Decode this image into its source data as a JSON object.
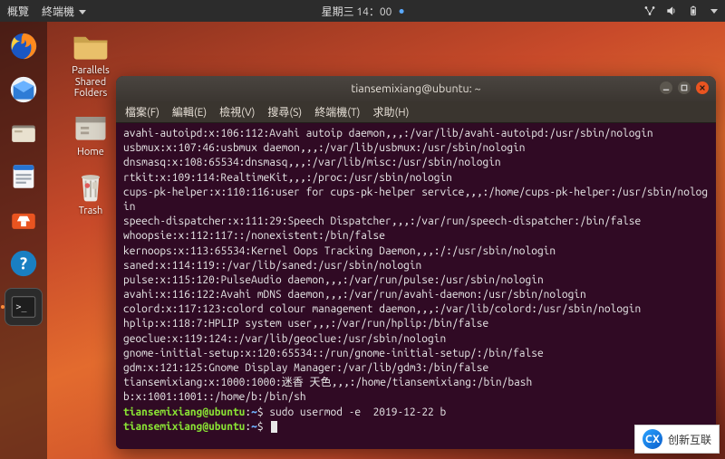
{
  "top_panel": {
    "overview": "概覽",
    "app_name": "終端機",
    "clock": "星期三 14：00"
  },
  "desktop_icons": {
    "parallels": "Parallels\nShared\nFolders",
    "home": "Home",
    "trash": "Trash"
  },
  "terminal": {
    "title": "tiansemixiang@ubuntu: ~",
    "menu": {
      "file": "檔案(F)",
      "edit": "編輯(E)",
      "view": "檢視(V)",
      "search": "搜尋(S)",
      "terminal": "終端機(T)",
      "help": "求助(H)"
    },
    "lines": [
      "avahi-autoipd:x:106:112:Avahi autoip daemon,,,:/var/lib/avahi-autoipd:/usr/sbin/nologin",
      "usbmux:x:107:46:usbmux daemon,,,:/var/lib/usbmux:/usr/sbin/nologin",
      "dnsmasq:x:108:65534:dnsmasq,,,:/var/lib/misc:/usr/sbin/nologin",
      "rtkit:x:109:114:RealtimeKit,,,:/proc:/usr/sbin/nologin",
      "cups-pk-helper:x:110:116:user for cups-pk-helper service,,,:/home/cups-pk-helper:/usr/sbin/nologin",
      "speech-dispatcher:x:111:29:Speech Dispatcher,,,:/var/run/speech-dispatcher:/bin/false",
      "whoopsie:x:112:117::/nonexistent:/bin/false",
      "kernoops:x:113:65534:Kernel Oops Tracking Daemon,,,:/:/usr/sbin/nologin",
      "saned:x:114:119::/var/lib/saned:/usr/sbin/nologin",
      "pulse:x:115:120:PulseAudio daemon,,,:/var/run/pulse:/usr/sbin/nologin",
      "avahi:x:116:122:Avahi mDNS daemon,,,:/var/run/avahi-daemon:/usr/sbin/nologin",
      "colord:x:117:123:colord colour management daemon,,,:/var/lib/colord:/usr/sbin/nologin",
      "hplip:x:118:7:HPLIP system user,,,:/var/run/hplip:/bin/false",
      "geoclue:x:119:124::/var/lib/geoclue:/usr/sbin/nologin",
      "gnome-initial-setup:x:120:65534::/run/gnome-initial-setup/:/bin/false",
      "gdm:x:121:125:Gnome Display Manager:/var/lib/gdm3:/bin/false",
      "tiansemixiang:x:1000:1000:迷香 天色,,,:/home/tiansemixiang:/bin/bash",
      "b:x:1001:1001::/home/b:/bin/sh"
    ],
    "prompt_user": "tiansemixiang@ubuntu",
    "prompt_path": "~",
    "prompt_suffix": "$",
    "command1": "sudo usermod -e  2019-12-22 b",
    "command2": ""
  },
  "watermark": {
    "logo": "CX",
    "text": "创新互联"
  }
}
